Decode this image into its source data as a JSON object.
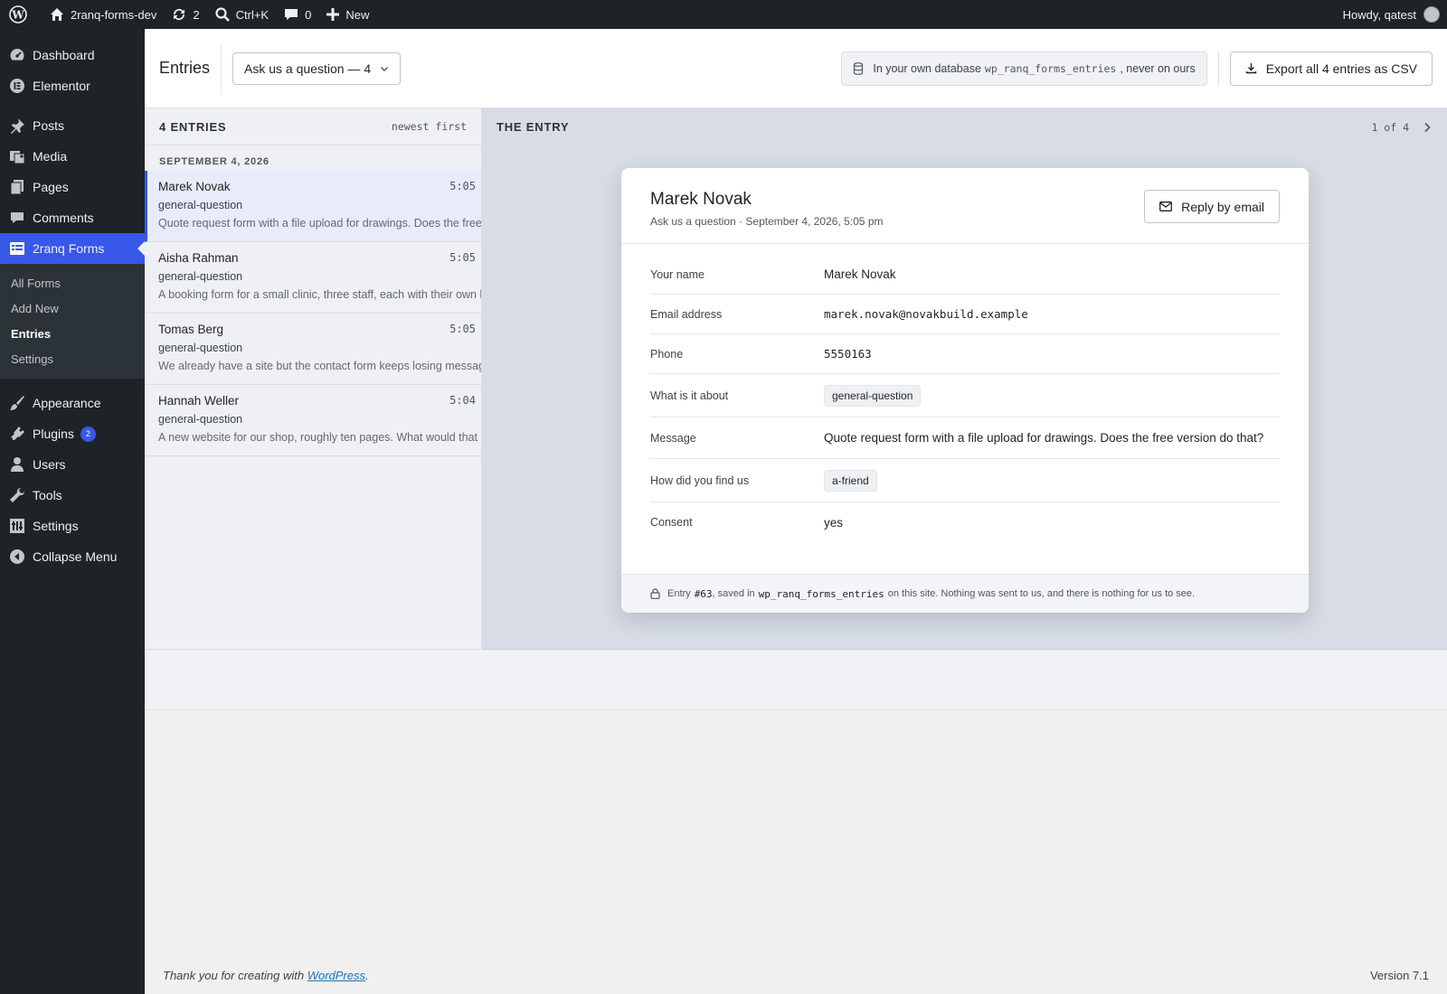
{
  "adminbar": {
    "site_name": "2ranq-forms-dev",
    "updates_count": "2",
    "search_shortcut": "Ctrl+K",
    "comments_count": "0",
    "new_label": "New",
    "howdy": "Howdy, qatest"
  },
  "sidebar": {
    "items": [
      {
        "label": "Dashboard",
        "icon": "dashboard-icon"
      },
      {
        "label": "Elementor",
        "icon": "elementor-icon"
      },
      {
        "label": "Posts",
        "icon": "pin-icon"
      },
      {
        "label": "Media",
        "icon": "media-icon"
      },
      {
        "label": "Pages",
        "icon": "pages-icon"
      },
      {
        "label": "Comments",
        "icon": "comment-icon"
      },
      {
        "label": "2ranq Forms",
        "icon": "forms-icon"
      },
      {
        "label": "Appearance",
        "icon": "brush-icon"
      },
      {
        "label": "Plugins",
        "icon": "plugin-icon",
        "badge": "2"
      },
      {
        "label": "Users",
        "icon": "user-icon"
      },
      {
        "label": "Tools",
        "icon": "wrench-icon"
      },
      {
        "label": "Settings",
        "icon": "settings-icon"
      },
      {
        "label": "Collapse Menu",
        "icon": "collapse-icon"
      }
    ],
    "submenu": [
      "All Forms",
      "Add New",
      "Entries",
      "Settings"
    ],
    "accent": "#3858e9"
  },
  "header": {
    "title": "Entries",
    "form_select": "Ask us a question — 4",
    "db_note_prefix": "In your own database",
    "db_table": "wp_ranq_forms_entries",
    "db_note_suffix": ", never on ours",
    "export_label": "Export all 4 entries as CSV"
  },
  "list": {
    "count_label": "4 ENTRIES",
    "sort_label": "newest first",
    "date_group": "SEPTEMBER 4, 2026",
    "entries": [
      {
        "name": "Marek Novak",
        "time": "5:05",
        "tag": "general-question",
        "preview": "Quote request form with a file upload for drawings. Does the free version do that?"
      },
      {
        "name": "Aisha Rahman",
        "time": "5:05",
        "tag": "general-question",
        "preview": "A booking form for a small clinic, three staff, each with their own hours."
      },
      {
        "name": "Tomas Berg",
        "time": "5:05",
        "tag": "general-question",
        "preview": "We already have a site but the contact form keeps losing messages."
      },
      {
        "name": "Hannah Weller",
        "time": "5:04",
        "tag": "general-question",
        "preview": "A new website for our shop, roughly ten pages. What would that cost?"
      }
    ]
  },
  "detail": {
    "label": "THE ENTRY",
    "pager": "1 of 4",
    "name": "Marek Novak",
    "meta": "Ask us a question · September 4, 2026, 5:05 pm",
    "reply_label": "Reply by email",
    "fields": [
      {
        "label": "Your name",
        "value": "Marek Novak"
      },
      {
        "label": "Email address",
        "value": "marek.novak@novakbuild.example"
      },
      {
        "label": "Phone",
        "value": "5550163"
      },
      {
        "label": "What is it about",
        "value": "general-question"
      },
      {
        "label": "Message",
        "value": "Quote request form with a file upload for drawings. Does the free version do that?"
      },
      {
        "label": "How did you find us",
        "value": "a-friend"
      },
      {
        "label": "Consent",
        "value": "yes"
      }
    ],
    "footer_prefix": "Entry",
    "entry_id": "#63",
    "footer_saved": ", saved in",
    "footer_table": "wp_ranq_forms_entries",
    "footer_suffix": "on this site. Nothing was sent to us, and there is nothing for us to see."
  },
  "footer": {
    "thanks_prefix": "Thank you for creating with",
    "wp_link": "WordPress",
    "thanks_suffix": ".",
    "version": "Version 7.1"
  }
}
